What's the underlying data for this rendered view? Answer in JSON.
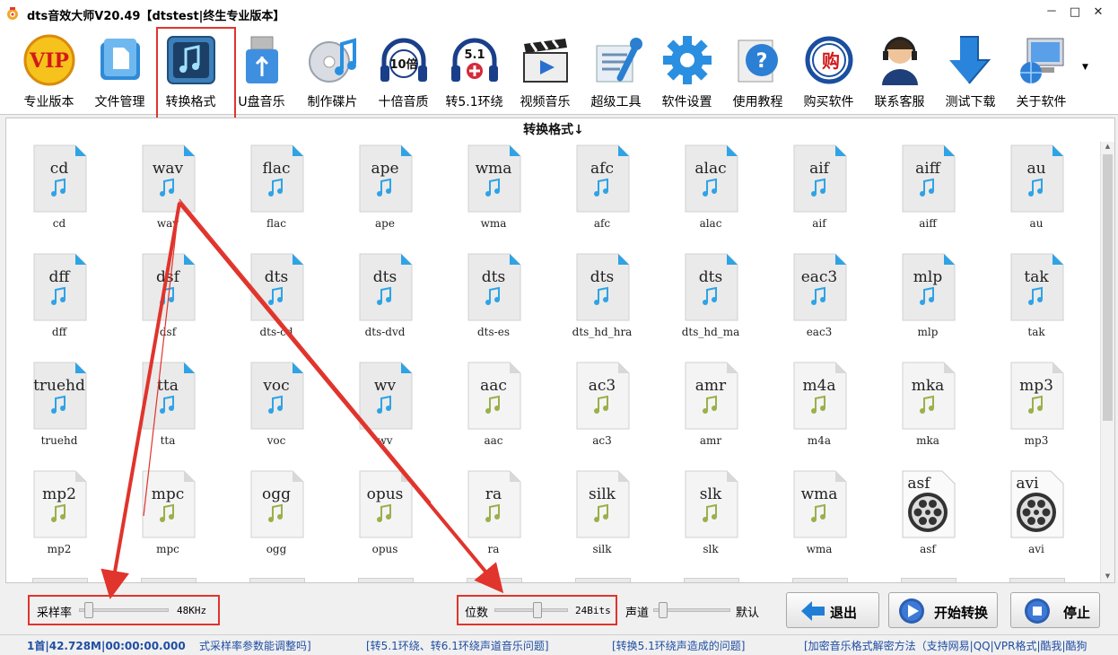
{
  "window": {
    "title": "dts音效大师V20.49【dtstest|终生专业版本】",
    "controls": [
      "－",
      "□",
      "✕"
    ]
  },
  "toolbar": [
    {
      "label": "专业版本",
      "icon": "vip-badge-icon"
    },
    {
      "label": "文件管理",
      "icon": "file-manager-icon"
    },
    {
      "label": "转换格式",
      "icon": "music-note-convert-icon",
      "selected": true
    },
    {
      "label": "U盘音乐",
      "icon": "usb-drive-icon"
    },
    {
      "label": "制作碟片",
      "icon": "disc-music-icon"
    },
    {
      "label": "十倍音质",
      "icon": "headphones-10x-icon",
      "badge": "10倍"
    },
    {
      "label": "转5.1环绕",
      "icon": "headphones-51-icon",
      "badge": "5.1"
    },
    {
      "label": "视频音乐",
      "icon": "clapper-video-icon"
    },
    {
      "label": "超级工具",
      "icon": "tools-wrench-icon"
    },
    {
      "label": "软件设置",
      "icon": "gear-icon"
    },
    {
      "label": "使用教程",
      "icon": "help-question-icon"
    },
    {
      "label": "购买软件",
      "icon": "buy-cart-icon",
      "badge": "购"
    },
    {
      "label": "联系客服",
      "icon": "customer-service-icon"
    },
    {
      "label": "测试下载",
      "icon": "download-arrow-icon"
    },
    {
      "label": "关于软件",
      "icon": "computer-globe-icon"
    }
  ],
  "grid": {
    "header": "转换格式↓",
    "formats": [
      {
        "icon_text": "cd",
        "label": "cd",
        "kind": "lossless"
      },
      {
        "icon_text": "wav",
        "label": "wav",
        "kind": "lossless"
      },
      {
        "icon_text": "flac",
        "label": "flac",
        "kind": "lossless"
      },
      {
        "icon_text": "ape",
        "label": "ape",
        "kind": "lossless"
      },
      {
        "icon_text": "wma",
        "label": "wma",
        "kind": "lossless"
      },
      {
        "icon_text": "afc",
        "label": "afc",
        "kind": "lossless"
      },
      {
        "icon_text": "alac",
        "label": "alac",
        "kind": "lossless"
      },
      {
        "icon_text": "aif",
        "label": "aif",
        "kind": "lossless"
      },
      {
        "icon_text": "aiff",
        "label": "aiff",
        "kind": "lossless"
      },
      {
        "icon_text": "au",
        "label": "au",
        "kind": "lossless"
      },
      {
        "icon_text": "dff",
        "label": "dff",
        "kind": "lossless"
      },
      {
        "icon_text": "dsf",
        "label": "dsf",
        "kind": "lossless"
      },
      {
        "icon_text": "dts",
        "label": "dts-cd",
        "kind": "lossless"
      },
      {
        "icon_text": "dts",
        "label": "dts-dvd",
        "kind": "lossless"
      },
      {
        "icon_text": "dts",
        "label": "dts-es",
        "kind": "lossless"
      },
      {
        "icon_text": "dts",
        "label": "dts_hd_hra",
        "kind": "lossless"
      },
      {
        "icon_text": "dts",
        "label": "dts_hd_ma",
        "kind": "lossless"
      },
      {
        "icon_text": "eac3",
        "label": "eac3",
        "kind": "lossless"
      },
      {
        "icon_text": "mlp",
        "label": "mlp",
        "kind": "lossless"
      },
      {
        "icon_text": "tak",
        "label": "tak",
        "kind": "lossless"
      },
      {
        "icon_text": "truehd",
        "label": "truehd",
        "kind": "lossless"
      },
      {
        "icon_text": "tta",
        "label": "tta",
        "kind": "lossless"
      },
      {
        "icon_text": "voc",
        "label": "voc",
        "kind": "lossless"
      },
      {
        "icon_text": "wv",
        "label": "wv",
        "kind": "lossless"
      },
      {
        "icon_text": "aac",
        "label": "aac",
        "kind": "lossy"
      },
      {
        "icon_text": "ac3",
        "label": "ac3",
        "kind": "lossy"
      },
      {
        "icon_text": "amr",
        "label": "amr",
        "kind": "lossy"
      },
      {
        "icon_text": "m4a",
        "label": "m4a",
        "kind": "lossy"
      },
      {
        "icon_text": "mka",
        "label": "mka",
        "kind": "lossy"
      },
      {
        "icon_text": "mp3",
        "label": "mp3",
        "kind": "lossy"
      },
      {
        "icon_text": "mp2",
        "label": "mp2",
        "kind": "lossy"
      },
      {
        "icon_text": "mpc",
        "label": "mpc",
        "kind": "lossy"
      },
      {
        "icon_text": "ogg",
        "label": "ogg",
        "kind": "lossy"
      },
      {
        "icon_text": "opus",
        "label": "opus",
        "kind": "lossy"
      },
      {
        "icon_text": "ra",
        "label": "ra",
        "kind": "lossy"
      },
      {
        "icon_text": "silk",
        "label": "silk",
        "kind": "lossy"
      },
      {
        "icon_text": "slk",
        "label": "slk",
        "kind": "lossy"
      },
      {
        "icon_text": "wma",
        "label": "wma",
        "kind": "lossy"
      },
      {
        "icon_text": "asf",
        "label": "asf",
        "kind": "video"
      },
      {
        "icon_text": "avi",
        "label": "avi",
        "kind": "video"
      }
    ]
  },
  "controls": {
    "sample_rate": {
      "label": "采样率",
      "value": "48KHz",
      "level": 0.07
    },
    "bit_depth": {
      "label": "位数",
      "value": "24Bits",
      "level": 0.6
    },
    "channels": {
      "label": "声道",
      "value": "默认",
      "level": 0.08
    },
    "buttons": {
      "exit": "退出",
      "start": "开始转换",
      "stop": "停止"
    }
  },
  "status": {
    "info": "1首|42.728M|00:00:00.000",
    "link1": "式采样率参数能调整吗]",
    "link2": "[转5.1环绕、转6.1环绕声道音乐问题]",
    "link3": "[转换5.1环绕声造成的问题]",
    "link4": "[加密音乐格式解密方法（支持网易|QQ|VPR格式|酷我|酷狗"
  },
  "colors": {
    "accent_red": "#e0342c",
    "lossless_note": "#2ea3e6",
    "lossy_note": "#9ab04a",
    "status_link": "#1f4ea3"
  }
}
